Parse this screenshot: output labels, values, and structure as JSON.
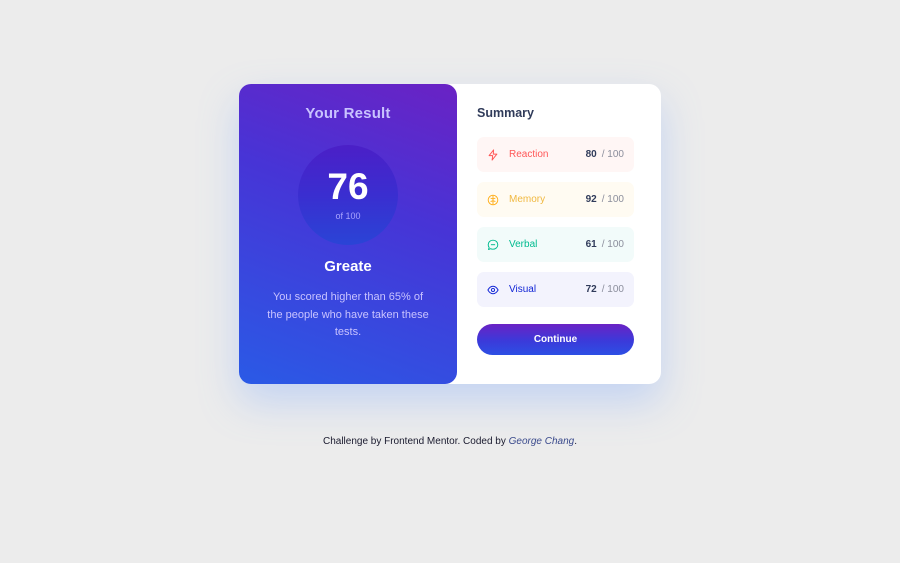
{
  "result": {
    "title": "Your Result",
    "score": "76",
    "score_of": "of 100",
    "grade": "Greate",
    "description": "You scored higher than 65% of the people who have taken these tests."
  },
  "summary": {
    "title": "Summary",
    "items": [
      {
        "label": "Reaction",
        "score": "80",
        "max": "/ 100",
        "icon": "lightning-icon",
        "color": "#ff5757"
      },
      {
        "label": "Memory",
        "score": "92",
        "max": "/ 100",
        "icon": "brain-icon",
        "color": "#ffb01f"
      },
      {
        "label": "Verbal",
        "score": "61",
        "max": "/ 100",
        "icon": "chat-bubble-icon",
        "color": "#00bb8f"
      },
      {
        "label": "Visual",
        "score": "72",
        "max": "/ 100",
        "icon": "eye-icon",
        "color": "#1125d6"
      }
    ],
    "button_label": "Continue"
  },
  "footer": {
    "prefix": "Challenge by Frontend Mentor. Coded by",
    "author": "George Chang",
    "suffix": "."
  }
}
